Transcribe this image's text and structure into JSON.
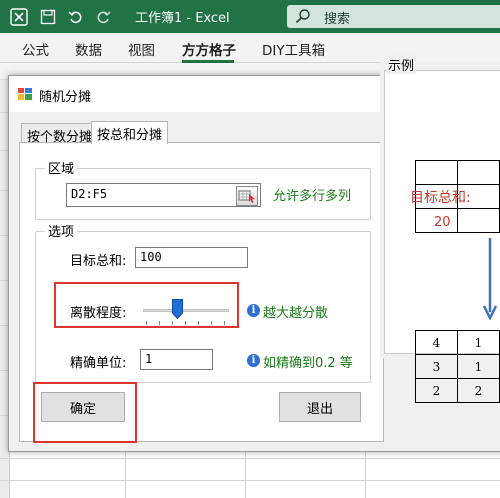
{
  "excel": {
    "title": "工作簿1 - Excel",
    "search_label": "搜索",
    "ribbon_tabs": [
      "公式",
      "数据",
      "视图",
      "方方格子",
      "DIY工具箱"
    ],
    "active_tab": "方方格子",
    "accent_color": "#217346"
  },
  "dialog": {
    "title": "随机分摊",
    "tabs": [
      "按个数分摊",
      "按总和分摊"
    ],
    "active_tab": "按总和分摊",
    "area_group": {
      "title": "区域",
      "range_value": "D2:F5",
      "hint": "允许多行多列"
    },
    "options_group": {
      "title": "选项",
      "target_sum_label": "目标总和:",
      "target_sum_value": "100",
      "dispersion_label": "离散程度:",
      "dispersion_level": 0.4,
      "dispersion_hint": "越大越分散",
      "precision_label": "精确单位:",
      "precision_value": "1",
      "precision_hint": "如精确到0.2 等"
    },
    "ok_button": "确定",
    "exit_button": "退出",
    "example": {
      "title": "示例",
      "target_label": "目标总和:",
      "target_value": "20",
      "result_rows": [
        [
          "4",
          "1"
        ],
        [
          "3",
          "1"
        ],
        [
          "2",
          "2"
        ]
      ]
    }
  },
  "colors": {
    "highlight_border": "#e0332e",
    "hint_green": "#1a7a1a",
    "example_red": "#c0392b"
  }
}
